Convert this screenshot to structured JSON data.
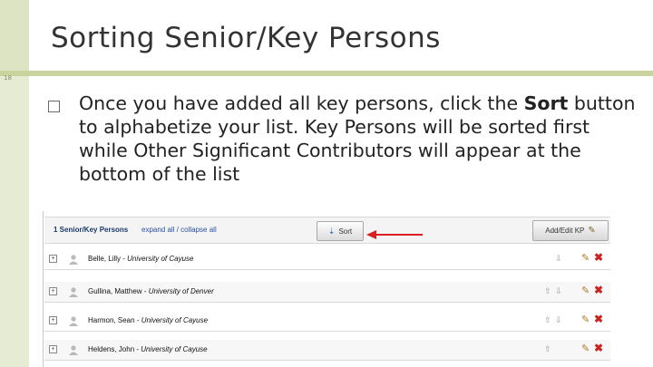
{
  "slide": {
    "title": "Sorting Senior/Key Persons",
    "number": "18",
    "bullet_text_before": "Once you have added all key persons, click the ",
    "bullet_bold": "Sort",
    "bullet_text_after": " button to alphabetize your list. Key Persons will be sorted first while Other Significant Contributors will appear at the bottom of the list"
  },
  "panel": {
    "section_title": "1 Senior/Key Persons",
    "expand_link": "expand all / collapse all",
    "sort_label": "Sort",
    "add_edit_label": "Add/Edit KP",
    "rows": [
      {
        "expander": "+",
        "name": "Belle, Lilly",
        "sep": " - ",
        "org": "University of Cayuse",
        "up": "",
        "down": "⇩"
      },
      {
        "expander": "+",
        "name": "Gullina, Matthew",
        "sep": " - ",
        "org": "University of Denver",
        "up": "⇧",
        "down": "⇩"
      },
      {
        "expander": "+",
        "name": "Harmon, Sean",
        "sep": " - ",
        "org": "University of Cayuse",
        "up": "⇧",
        "down": "⇩"
      },
      {
        "expander": "+",
        "name": "Heldens, John",
        "sep": " - ",
        "org": "University of Cayuse",
        "up": "⇧",
        "down": ""
      }
    ]
  },
  "icons": {
    "sort": "sort-icon",
    "add_edit": "pencil-icon",
    "edit": "pencil-icon",
    "delete": "delete-x-icon",
    "person": "person-icon"
  },
  "colors": {
    "accent_bar": "#c9d39e",
    "arrow": "#d9201f",
    "delete": "#cc2222"
  }
}
